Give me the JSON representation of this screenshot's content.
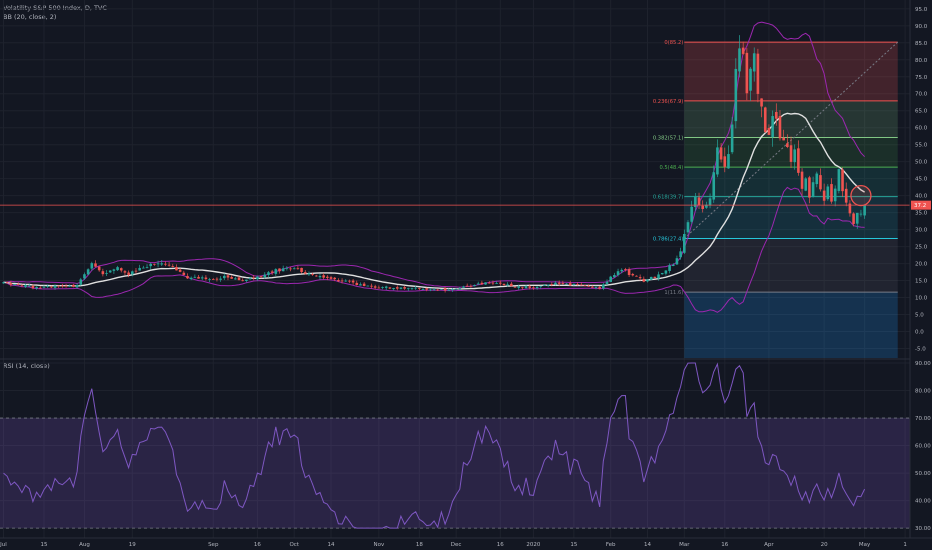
{
  "header": {
    "symbol_line": "Volatility S&P 500 Index, D, TVC",
    "bb_line": "BB (20, close, 2)",
    "rsi_line": "RSI (14, close)"
  },
  "colors": {
    "background": "#131722",
    "grid": "#1e222d",
    "up": "#26a69a",
    "down": "#ef5350",
    "bb_band": "#9c27b0",
    "bb_basis": "#e0e0e0",
    "rsi_line": "#7e57c2",
    "rsi_fill": "#7e57c2",
    "price_line": "#ef5350",
    "axis_text": "#b2b5be"
  },
  "chart_data": [
    {
      "type": "candlestick",
      "title": "Volatility S&P 500 Index, D, TVC",
      "indicator": "BB (20, close, 2)",
      "y_axis": {
        "side": "right",
        "ticks": [
          "95.0",
          "90.0",
          "85.0",
          "80.0",
          "75.0",
          "70.0",
          "65.0",
          "60.0",
          "55.0",
          "50.0",
          "45.0",
          "40.0",
          "35.0",
          "30.0",
          "25.0",
          "20.0",
          "15.0",
          "10.0",
          "5.0",
          "0.0",
          "-5.0"
        ],
        "ylim": [
          -7.8,
          97.6
        ]
      },
      "x_axis": {
        "ticks": [
          "Jul",
          "15",
          "Aug",
          "19",
          "Sep",
          "16",
          "Oct",
          "14",
          "Nov",
          "18",
          "Dec",
          "16",
          "2020",
          "15",
          "Feb",
          "14",
          "Mar",
          "16",
          "Apr",
          "20",
          "May",
          "1"
        ],
        "tick_day": [
          0,
          11,
          22,
          35,
          57,
          69,
          79,
          89,
          102,
          113,
          123,
          135,
          144,
          155,
          165,
          175,
          185,
          196,
          208,
          223,
          234,
          245
        ]
      },
      "last_price_label": "37.2",
      "last_price": 37.2,
      "fibonacci": {
        "from": 11.6,
        "to": 85.2,
        "levels": [
          {
            "label": "0(85.2)",
            "value": 85.2,
            "color": "#ef5350"
          },
          {
            "label": "0.236(67.9)",
            "value": 67.9,
            "color": "#ef5350"
          },
          {
            "label": "0.382(57.1)",
            "value": 57.1,
            "color": "#81c784"
          },
          {
            "label": "0.5(48.4)",
            "value": 48.4,
            "color": "#4caf50"
          },
          {
            "label": "0.618(39.7)",
            "value": 39.7,
            "color": "#26a69a"
          },
          {
            "label": "0.786(27.4)",
            "value": 27.4,
            "color": "#26c6da"
          },
          {
            "label": "1(11.6)",
            "value": 11.6,
            "color": "#787b86"
          }
        ]
      },
      "highlight_circle": {
        "day": 233,
        "value": 40.0
      },
      "diagonal_from": {
        "day": 185,
        "value": 27.4
      },
      "diagonal_to": {
        "day": 243,
        "value": 85.2
      }
    },
    {
      "type": "line",
      "title": "RSI (14, close)",
      "y_axis": {
        "side": "right",
        "ticks": [
          "90.00",
          "80.00",
          "70.00",
          "60.00",
          "50.00",
          "40.00",
          "30.00"
        ],
        "ylim": [
          26.4,
          91.1
        ]
      },
      "bands": {
        "upper": 70,
        "lower": 30
      }
    }
  ]
}
